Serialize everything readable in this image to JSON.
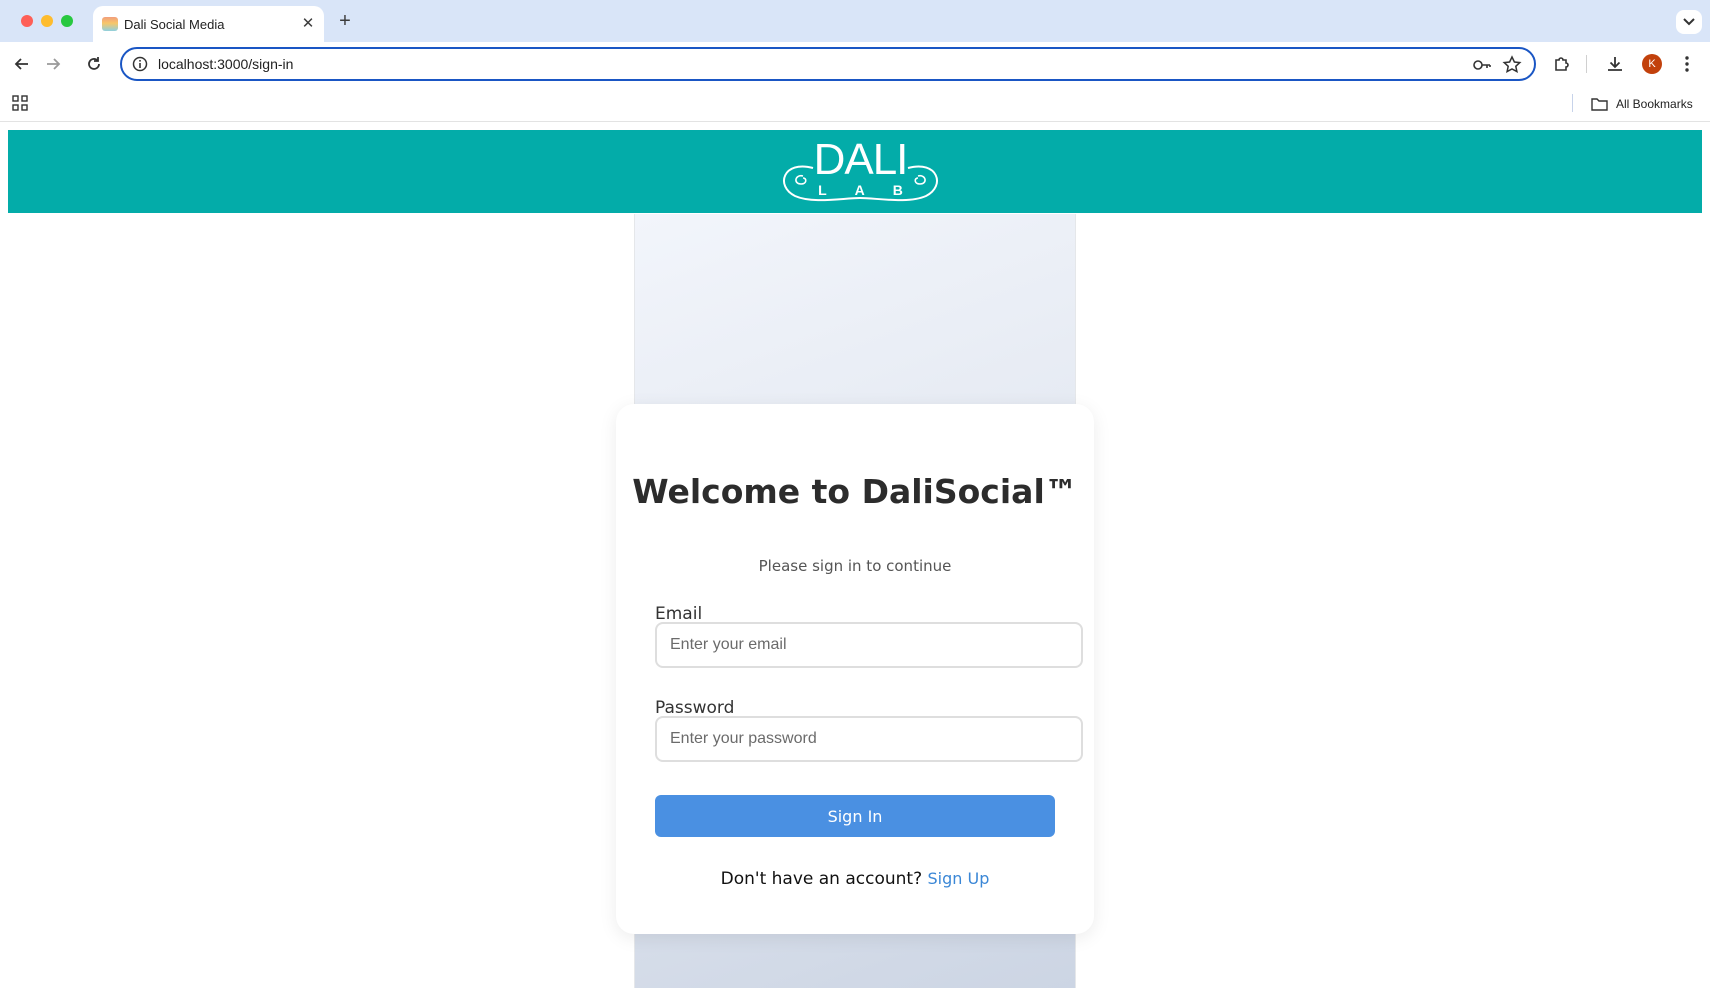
{
  "browser": {
    "tab_title": "Dali Social Media",
    "url": "localhost:3000/sign-in",
    "profile_initial": "K",
    "bookmarks_label": "All Bookmarks"
  },
  "header": {
    "logo_main": "DALI",
    "logo_sub": "LAB"
  },
  "signin": {
    "title": "Welcome to DaliSocial™",
    "subtitle": "Please sign in to continue",
    "email_label": "Email",
    "email_placeholder": "Enter your email",
    "email_value": "",
    "password_label": "Password",
    "password_placeholder": "Enter your password",
    "password_value": "",
    "submit_label": "Sign In",
    "signup_prompt": "Don't have an account?",
    "signup_link": "Sign Up"
  },
  "colors": {
    "header_teal": "#03aca9",
    "button_blue": "#4a90e2",
    "link_blue": "#3b87d6"
  }
}
